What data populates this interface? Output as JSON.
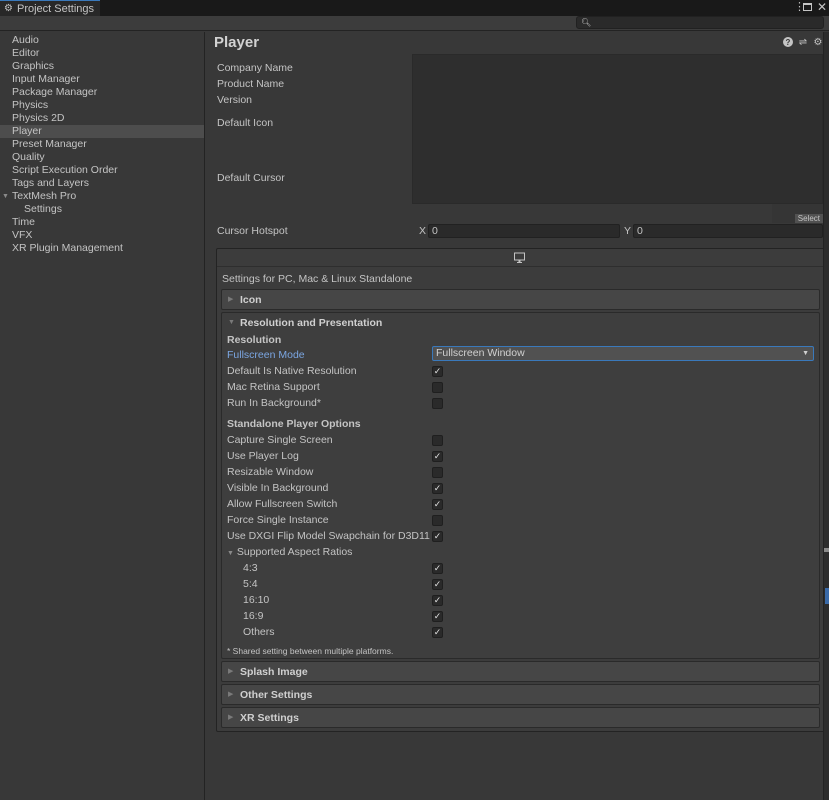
{
  "window": {
    "tab_title": "Project Settings",
    "icons": [
      "gear-icon",
      "kebab-menu-icon",
      "maximize-icon",
      "close-icon"
    ]
  },
  "search": {
    "placeholder": "",
    "value": ""
  },
  "sidebar": {
    "items": [
      {
        "label": "Audio"
      },
      {
        "label": "Editor"
      },
      {
        "label": "Graphics"
      },
      {
        "label": "Input Manager"
      },
      {
        "label": "Package Manager"
      },
      {
        "label": "Physics"
      },
      {
        "label": "Physics 2D"
      },
      {
        "label": "Player",
        "selected": true
      },
      {
        "label": "Preset Manager"
      },
      {
        "label": "Quality"
      },
      {
        "label": "Script Execution Order"
      },
      {
        "label": "Tags and Layers"
      },
      {
        "label": "TextMesh Pro",
        "expanded": true
      },
      {
        "label": "Settings",
        "child": true
      },
      {
        "label": "Time"
      },
      {
        "label": "VFX"
      },
      {
        "label": "XR Plugin Management"
      }
    ]
  },
  "main": {
    "title": "Player",
    "header_icons": [
      "help-icon",
      "presets-icon",
      "settings-gear-icon"
    ],
    "fields": {
      "company_name": "Company Name",
      "product_name": "Product Name",
      "version": "Version",
      "default_icon": "Default Icon",
      "default_cursor": "Default Cursor",
      "cursor_hotspot": "Cursor Hotspot"
    },
    "select_button": "Select",
    "hotspot": {
      "x_label": "X",
      "x_value": "0",
      "y_label": "Y",
      "y_value": "0"
    },
    "platform": {
      "icon": "monitor-icon",
      "title": "Settings for PC, Mac & Linux Standalone",
      "sections": {
        "icon": "Icon",
        "resolution": "Resolution and Presentation",
        "splash": "Splash Image",
        "other": "Other Settings",
        "xr": "XR Settings"
      },
      "resolution": {
        "heading": "Resolution",
        "fullscreen_mode_label": "Fullscreen Mode",
        "fullscreen_mode_value": "Fullscreen Window",
        "options": [
          {
            "label": "Default Is Native Resolution",
            "checked": true
          },
          {
            "label": "Mac Retina Support",
            "checked": false
          },
          {
            "label": "Run In Background*",
            "checked": false
          }
        ]
      },
      "standalone": {
        "heading": "Standalone Player Options",
        "options": [
          {
            "label": "Capture Single Screen",
            "checked": false
          },
          {
            "label": "Use Player Log",
            "checked": true
          },
          {
            "label": "Resizable Window",
            "checked": false
          },
          {
            "label": "Visible In Background",
            "checked": true
          },
          {
            "label": "Allow Fullscreen Switch",
            "checked": true
          },
          {
            "label": "Force Single Instance",
            "checked": false
          },
          {
            "label": "Use DXGI Flip Model Swapchain for D3D11",
            "checked": true
          }
        ]
      },
      "aspect": {
        "heading": "Supported Aspect Ratios",
        "options": [
          {
            "label": "4:3",
            "checked": true
          },
          {
            "label": "5:4",
            "checked": true
          },
          {
            "label": "16:10",
            "checked": true
          },
          {
            "label": "16:9",
            "checked": true
          },
          {
            "label": "Others",
            "checked": true
          }
        ]
      },
      "note": "* Shared setting between multiple platforms."
    }
  },
  "colors": {
    "accent": "#3a79bb",
    "label_blue": "#7ba6e2",
    "background": "#383838"
  }
}
